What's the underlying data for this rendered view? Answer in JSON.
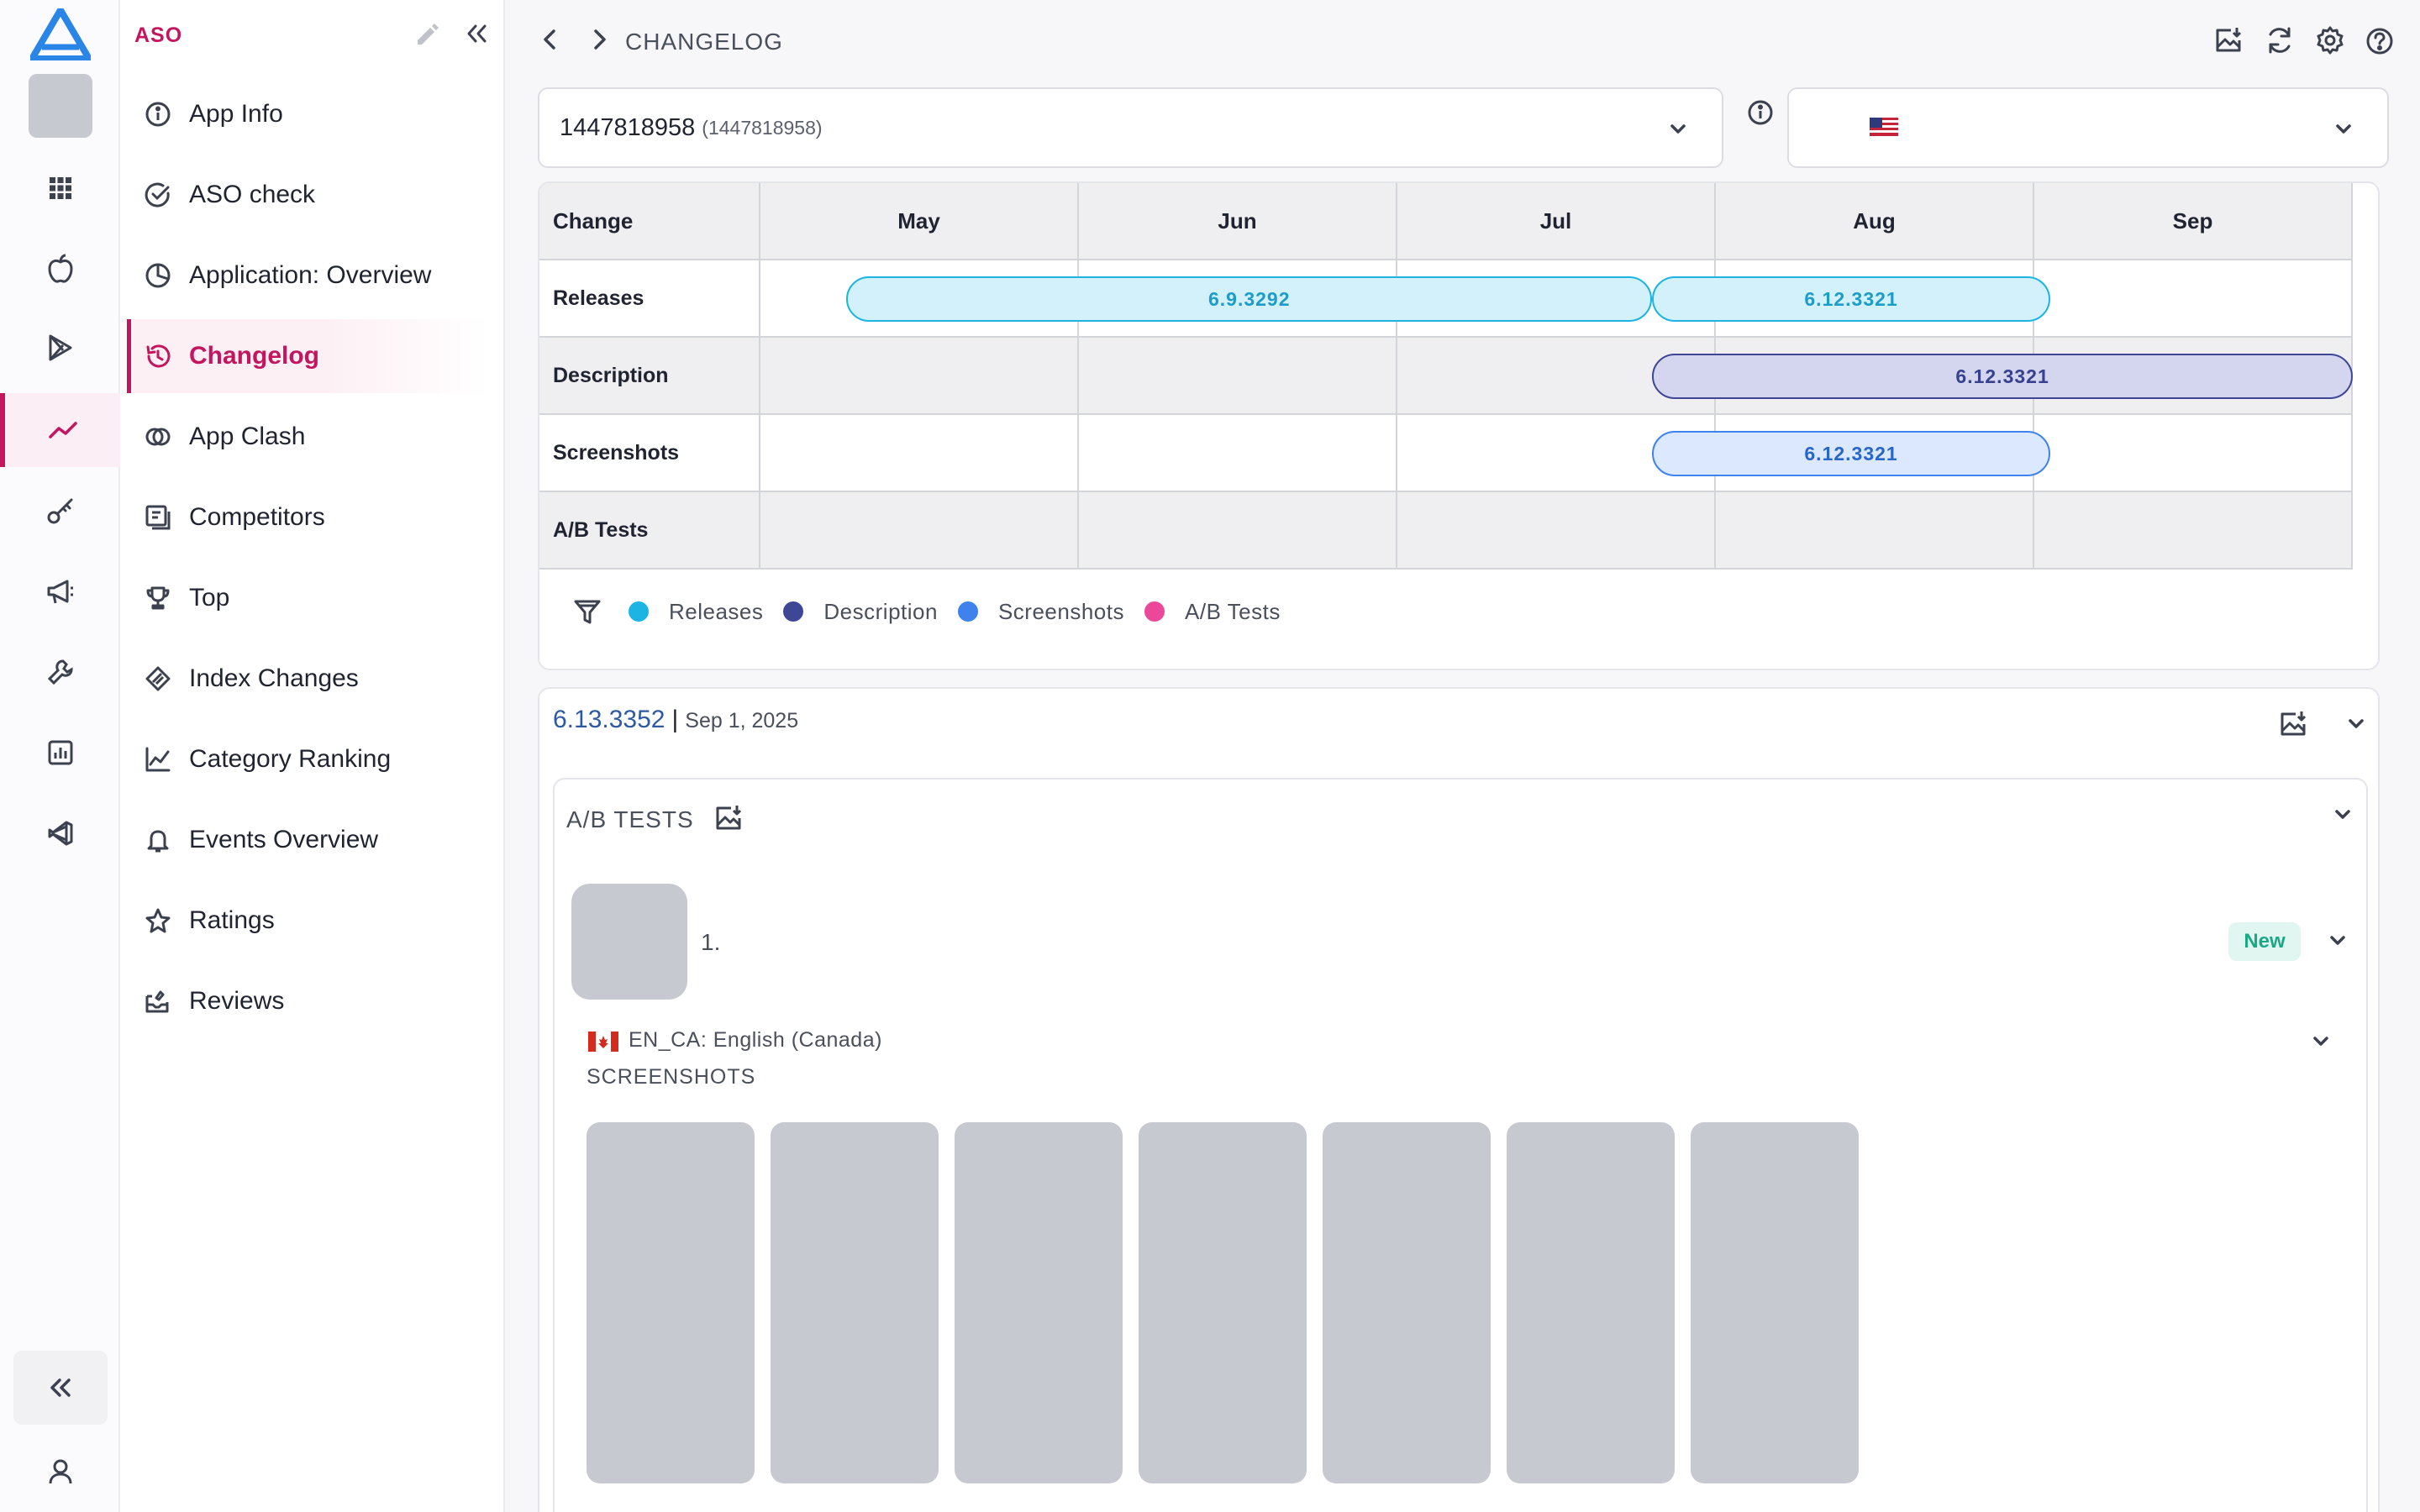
{
  "rail": {
    "items": [
      {
        "name": "rail-apps-grid",
        "icon": "grid-icon"
      },
      {
        "name": "rail-apple",
        "icon": "apple-icon"
      },
      {
        "name": "rail-google-play",
        "icon": "play-icon"
      },
      {
        "name": "rail-aso",
        "icon": "trend-icon",
        "active": true
      },
      {
        "name": "rail-keywords",
        "icon": "key-icon"
      },
      {
        "name": "rail-marketing",
        "icon": "megaphone-icon"
      },
      {
        "name": "rail-tools",
        "icon": "wrench-icon"
      },
      {
        "name": "rail-reports",
        "icon": "chart-icon"
      },
      {
        "name": "rail-integrations",
        "icon": "vscode-icon"
      }
    ]
  },
  "sidebar": {
    "title": "ASO",
    "items": [
      {
        "label": "App Info",
        "icon": "info-icon"
      },
      {
        "label": "ASO check",
        "icon": "check-circle-icon"
      },
      {
        "label": "Application: Overview",
        "icon": "pie-icon"
      },
      {
        "label": "Changelog",
        "icon": "history-icon",
        "active": true
      },
      {
        "label": "App Clash",
        "icon": "clash-icon"
      },
      {
        "label": "Competitors",
        "icon": "competitors-icon"
      },
      {
        "label": "Top",
        "icon": "trophy-icon"
      },
      {
        "label": "Index Changes",
        "icon": "index-icon"
      },
      {
        "label": "Category Ranking",
        "icon": "line-chart-icon"
      },
      {
        "label": "Events Overview",
        "icon": "bell-icon"
      },
      {
        "label": "Ratings",
        "icon": "star-icon"
      },
      {
        "label": "Reviews",
        "icon": "reviews-icon"
      }
    ]
  },
  "header": {
    "breadcrumb": "CHANGELOG"
  },
  "app_select": {
    "name": "1447818958",
    "sub": "(1447818958)"
  },
  "colors": {
    "accent": "#c4155f",
    "releases": "#1bb4e3",
    "description": "#3d4796",
    "screenshots": "#3f82ee",
    "ab_tests": "#ec4899"
  },
  "timeline": {
    "corner": "Change",
    "months": [
      "May",
      "Jun",
      "Jul",
      "Aug",
      "Sep"
    ],
    "rows": [
      "Releases",
      "Description",
      "Screenshots",
      "A/B Tests"
    ],
    "bars": [
      {
        "row": 0,
        "type": "rel",
        "label": "6.9.3292",
        "start": 0.27,
        "end": 2.8
      },
      {
        "row": 0,
        "type": "rel",
        "label": "6.12.3321",
        "start": 2.8,
        "end": 4.05
      },
      {
        "row": 1,
        "type": "desc",
        "label": "6.12.3321",
        "start": 2.8,
        "end": 5.0
      },
      {
        "row": 2,
        "type": "scr",
        "label": "6.12.3321",
        "start": 2.8,
        "end": 4.05
      }
    ],
    "legend": [
      {
        "label": "Releases",
        "color": "#1bb4e3"
      },
      {
        "label": "Description",
        "color": "#3d4796"
      },
      {
        "label": "Screenshots",
        "color": "#3f82ee"
      },
      {
        "label": "A/B Tests",
        "color": "#ec4899"
      }
    ]
  },
  "details": {
    "version": "6.13.3352",
    "separator": "|",
    "date": "Sep 1, 2025",
    "ab_title": "A/B TESTS",
    "test_number": "1.",
    "test_badge": "New",
    "locale": "EN_CA: English (Canada)",
    "screenshots_label": "SCREENSHOTS",
    "screenshot_count": 7
  }
}
